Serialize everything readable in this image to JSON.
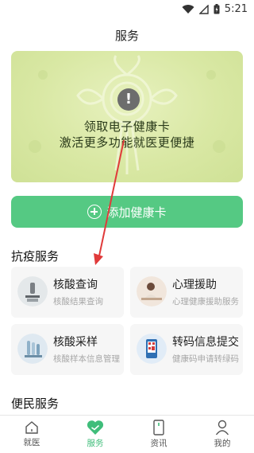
{
  "status_bar": {
    "time": "5:21",
    "icons": [
      "wifi-icon",
      "signal-icon",
      "battery-charging-icon"
    ]
  },
  "page": {
    "title": "服务"
  },
  "health_card": {
    "notice_icon": "alert-icon",
    "notice_symbol": "!",
    "line1": "领取电子健康卡",
    "line2": "激活更多功能就医更便捷"
  },
  "add_button": {
    "label": "添加健康卡",
    "icon": "plus-circle-icon"
  },
  "sections": {
    "epidemic": {
      "title": "抗疫服务",
      "tiles": [
        {
          "name": "核酸查询",
          "desc": "核酸结果查询"
        },
        {
          "name": "心理援助",
          "desc": "心理健康援助服务"
        },
        {
          "name": "核酸采样",
          "desc": "核酸样本信息管理"
        },
        {
          "name": "转码信息提交",
          "desc": "健康码申请转绿码"
        }
      ]
    },
    "convenience": {
      "title": "便民服务"
    }
  },
  "tabbar": {
    "items": [
      {
        "label": "就医",
        "icon": "home-icon",
        "active": false
      },
      {
        "label": "服务",
        "icon": "heart-icon",
        "active": true
      },
      {
        "label": "资讯",
        "icon": "phone-icon",
        "active": false
      },
      {
        "label": "我的",
        "icon": "person-icon",
        "active": false
      }
    ]
  },
  "colors": {
    "accent": "#55c983",
    "active_tab": "#3fbd7a",
    "card_bg": "#d9e8a4",
    "annotation_arrow": "#e03a3a"
  }
}
